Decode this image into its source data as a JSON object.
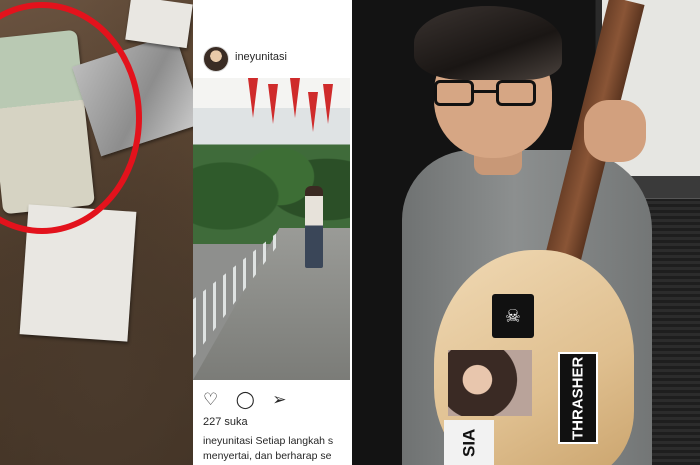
{
  "instagram": {
    "username": "ineyunitasi",
    "likes": "227 suka",
    "caption_user": "ineyunitasi",
    "caption_line1": "Setiap langkah s",
    "caption_line2": "menyertai, dan berharap se"
  },
  "stickers": {
    "thrasher": "THRASHER",
    "sia": "SIA"
  },
  "icons": {
    "like": "heart-icon",
    "comment": "comment-icon",
    "share": "send-icon"
  },
  "colors": {
    "circle": "#e3121c",
    "flag": "#cf2b2b"
  }
}
